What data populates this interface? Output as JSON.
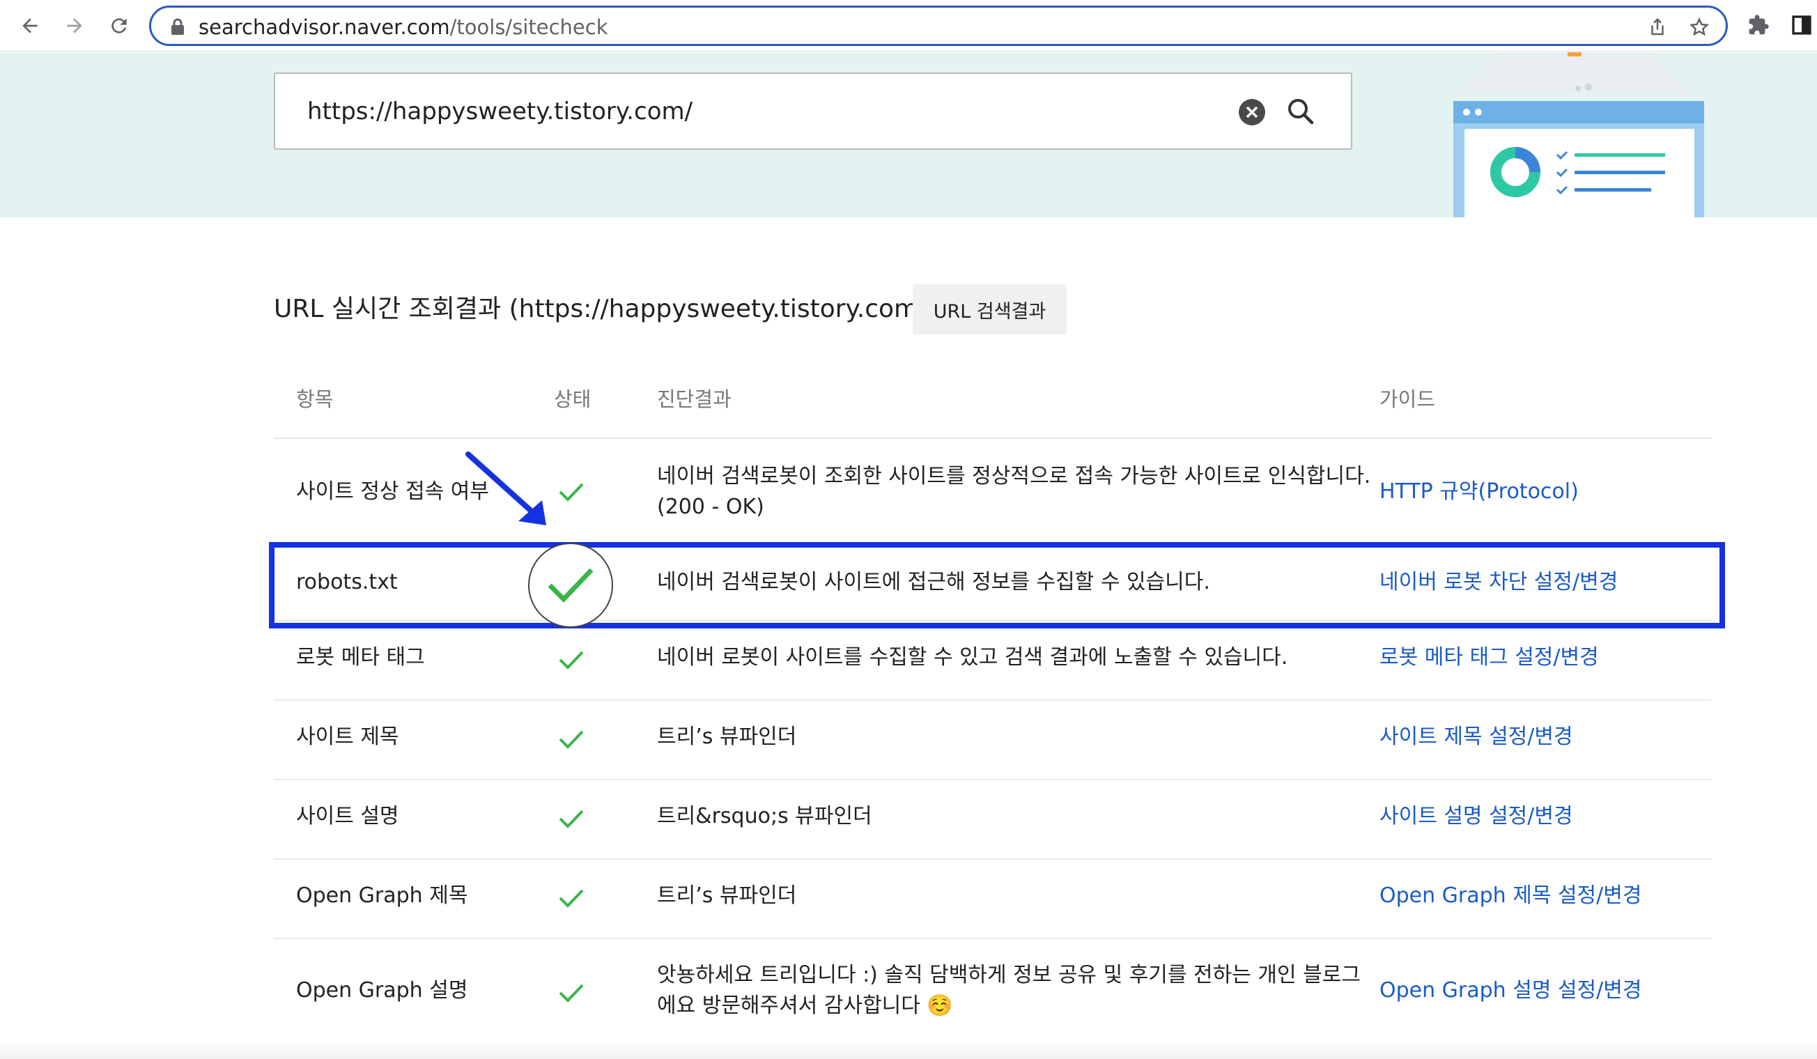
{
  "browser": {
    "url_host": "searchadvisor.naver.com",
    "url_path": "/tools/sitecheck"
  },
  "search": {
    "value": "https://happysweety.tistory.com/"
  },
  "result": {
    "title": "URL 실시간 조회결과 (https://happysweety.tistory.com/)",
    "url_search_button": "URL 검색결과"
  },
  "table": {
    "headers": {
      "item": "항목",
      "status": "상태",
      "diagnosis": "진단결과",
      "guide": "가이드"
    },
    "rows": [
      {
        "item": "사이트 정상 접속 여부",
        "status": "ok",
        "diagnosis_line1": "네이버 검색로봇이 조회한 사이트를 정상적으로 접속 가능한 사이트로 인식합니다.",
        "diagnosis_line2": "(200 - OK)",
        "guide": "HTTP 규약(Protocol)"
      },
      {
        "item": "robots.txt",
        "status": "ok",
        "diagnosis_line1": "네이버 검색로봇이 사이트에 접근해 정보를 수집할 수 있습니다.",
        "diagnosis_line2": "",
        "guide": "네이버 로봇 차단 설정/변경"
      },
      {
        "item": "로봇 메타 태그",
        "status": "ok",
        "diagnosis_line1": "네이버 로봇이 사이트를 수집할 수 있고 검색 결과에 노출할 수 있습니다.",
        "diagnosis_line2": "",
        "guide": "로봇 메타 태그 설정/변경"
      },
      {
        "item": "사이트 제목",
        "status": "ok",
        "diagnosis_line1": "트리’s 뷰파인더",
        "diagnosis_line2": "",
        "guide": "사이트 제목 설정/변경"
      },
      {
        "item": "사이트 설명",
        "status": "ok",
        "diagnosis_line1": "트리&rsquo;s 뷰파인더",
        "diagnosis_line2": "",
        "guide": "사이트 설명 설정/변경"
      },
      {
        "item": "Open Graph 제목",
        "status": "ok",
        "diagnosis_line1": "트리’s 뷰파인더",
        "diagnosis_line2": "",
        "guide": "Open Graph 제목 설정/변경"
      },
      {
        "item": "Open Graph 설명",
        "status": "ok",
        "diagnosis_line1": "앗뇽하세요 트리입니다 :) 솔직 담백하게 정보 공유 및 후기를 전하는 개인 블로그",
        "diagnosis_line2": "에요 방문해주셔서 감사합니다 ☺️",
        "guide": "Open Graph 설명 설정/변경"
      }
    ]
  },
  "colors": {
    "hero_bg": "#e3f3f1",
    "link": "#1a5bc4",
    "check": "#3bb54a",
    "annotation": "#1432e0"
  },
  "icons": {
    "back": "arrow-left-icon",
    "forward": "arrow-right-icon",
    "reload": "reload-icon",
    "lock": "lock-icon",
    "share": "share-icon",
    "bookmark": "star-icon",
    "extensions": "puzzle-icon",
    "sidebar": "sidebar-icon",
    "clear": "clear-icon",
    "search": "search-icon",
    "status": "check-icon"
  }
}
